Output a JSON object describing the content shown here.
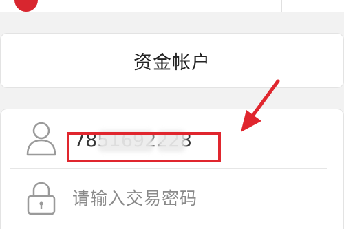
{
  "account_type": {
    "label": "资金帐户"
  },
  "login": {
    "account_value": "7851692228",
    "password_placeholder": "请输入交易密码"
  },
  "colors": {
    "highlight": "#e0262e",
    "brand_red": "#d8262f"
  },
  "icons": {
    "account": "user-icon",
    "password": "lock-icon",
    "annotation": "arrow-icon"
  }
}
